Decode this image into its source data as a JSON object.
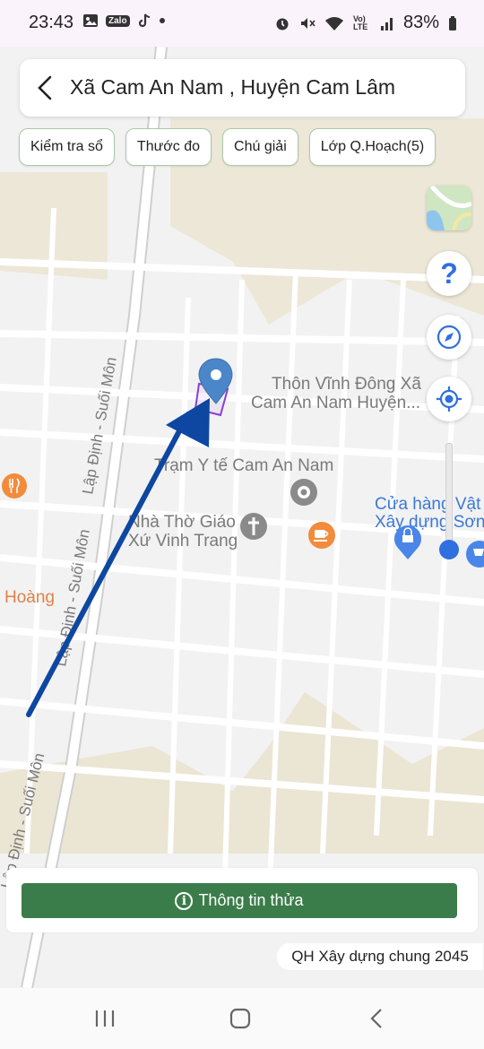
{
  "status_bar": {
    "time": "23:43",
    "left_icons": [
      "image-icon",
      "zalo-icon",
      "tiktok-icon",
      "dot-icon"
    ],
    "zalo_label": "Zalo",
    "right_icons": [
      "alarm-icon",
      "mute-icon",
      "wifi-icon",
      "volte-icon",
      "signal-icon"
    ],
    "volte_label": "Vo) LTE",
    "battery": "83%"
  },
  "header": {
    "back_icon": "chevron-left-icon",
    "title": "Xã Cam An Nam , Huyện Cam Lâm"
  },
  "chips": [
    {
      "label": "Kiểm tra sổ"
    },
    {
      "label": "Thước đo"
    },
    {
      "label": "Chú giải"
    },
    {
      "label": "Lớp Q.Hoạch(5)"
    }
  ],
  "side_controls": {
    "layer_icon": "map-layer-icon",
    "help_icon": "question-icon",
    "help_label": "?",
    "compass_icon": "compass-icon",
    "locate_icon": "my-location-icon",
    "zoom_level_fraction": 0.9
  },
  "map": {
    "labels": {
      "village": "Thôn Vĩnh Đông Xã",
      "village2": "Cam An Nam Huyện...",
      "clinic": "Trạm Y tế Cam An Nam",
      "church1": "Nhà Thờ Giáo",
      "church2": "Xứ Vinh Trang",
      "store1": "Cửa hàng Vật",
      "store2": "Xây dựng Sơn",
      "hoang": "Hoàng",
      "road": "Lập Định - Suối Môn"
    },
    "colors": {
      "background": "#f2f2f2",
      "road": "#ffffff",
      "vegetation": "#ece6d6",
      "pin": "#4a86c8",
      "parcel": "#8a3fd1",
      "arrow": "#0d47a1",
      "poi_orange": "#f28b3c",
      "poi_grey": "#8a8a8a",
      "poi_blue": "#4a86e8",
      "store_text": "#3b78d8",
      "hoang_text": "#e0814a"
    }
  },
  "bottom": {
    "info_icon": "info-icon",
    "info_label": "Thông tin thửa",
    "plan_label": "QH Xây dựng chung 2045"
  },
  "nav_bar": {
    "items": [
      "recents-icon",
      "home-icon",
      "back-icon"
    ]
  }
}
